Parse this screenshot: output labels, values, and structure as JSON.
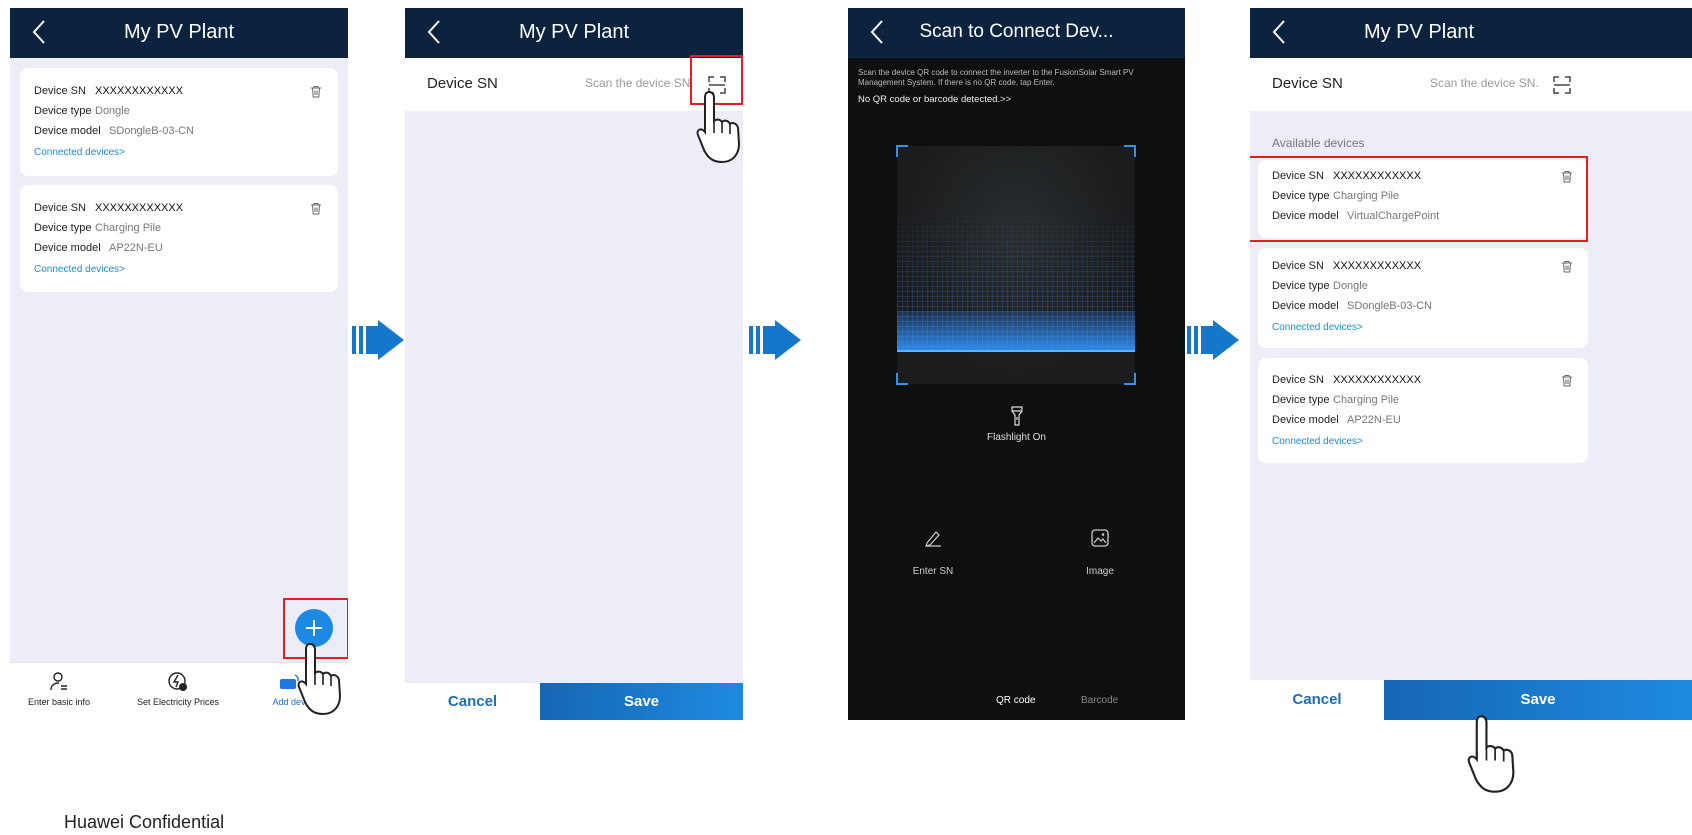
{
  "screens": {
    "s1": {
      "title": "My PV Plant",
      "devices": [
        {
          "sn_label": "Device SN",
          "sn": "XXXXXXXXXXXX",
          "type_label": "Device type",
          "type": "Dongle",
          "model_label": "Device model",
          "model": "SDongleB-03-CN",
          "link": "Connected devices>"
        },
        {
          "sn_label": "Device SN",
          "sn": "XXXXXXXXXXXX",
          "type_label": "Device type",
          "type": "Charging Pile",
          "model_label": "Device model",
          "model": "AP22N-EU",
          "link": "Connected devices>"
        }
      ],
      "bottom_nav": {
        "basic_info": "Enter basic info",
        "prices": "Set Electricity Prices",
        "add_device": "Add devi"
      }
    },
    "s2": {
      "title": "My PV Plant",
      "sn_label": "Device SN",
      "sn_placeholder": "Scan the device SN.",
      "cancel": "Cancel",
      "save": "Save"
    },
    "s3": {
      "title": "Scan to Connect Dev...",
      "description": "Scan the device QR code to connect the inverter to the FusionSolar Smart PV Management System. If there is no QR code, tap Enter.",
      "no_code": "No QR code or barcode detected.>>",
      "flashlight": "Flashlight On",
      "enter_sn": "Enter SN",
      "image": "Image",
      "mode_qr": "QR code",
      "mode_barcode": "Barcode"
    },
    "s4": {
      "title": "My PV Plant",
      "sn_label": "Device SN",
      "sn_placeholder": "Scan the device SN.",
      "available": "Available devices",
      "devices": [
        {
          "sn_label": "Device SN",
          "sn": "XXXXXXXXXXXX",
          "type_label": "Device type",
          "type": "Charging Pile",
          "model_label": "Device model",
          "model": "VirtualChargePoint"
        },
        {
          "sn_label": "Device SN",
          "sn": "XXXXXXXXXXXX",
          "type_label": "Device type",
          "type": "Dongle",
          "model_label": "Device model",
          "model": "SDongleB-03-CN",
          "link": "Connected devices>"
        },
        {
          "sn_label": "Device SN",
          "sn": "XXXXXXXXXXXX",
          "type_label": "Device type",
          "type": "Charging Pile",
          "model_label": "Device model",
          "model": "AP22N-EU",
          "link": "Connected devices>"
        }
      ],
      "cancel": "Cancel",
      "save": "Save"
    }
  },
  "footnote": "Huawei Confidential",
  "colors": {
    "appbar": "#0c2340",
    "page_bg": "#ecedf7",
    "accent_blue": "#1e88e5",
    "link_blue": "#1a8cd8",
    "highlight_red": "#e02020",
    "step_arrow": "#1577cc"
  }
}
